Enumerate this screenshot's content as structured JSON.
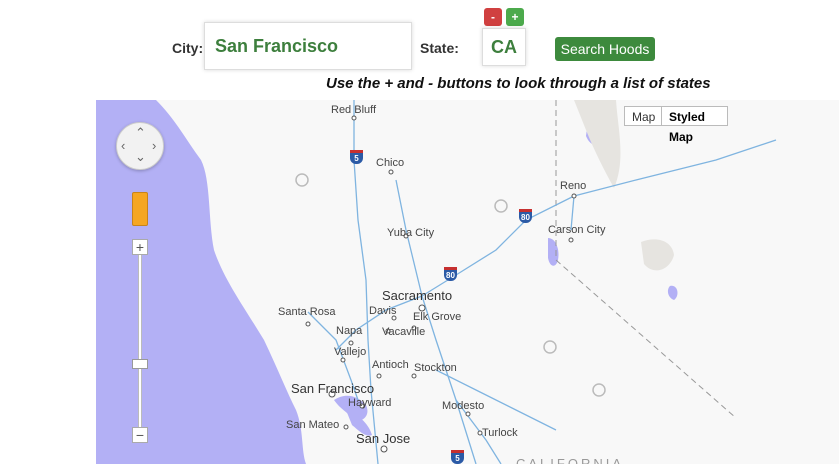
{
  "form": {
    "city_label": "City:",
    "city_value": "San Francisco",
    "state_label": "State:",
    "state_value": "CA",
    "minus_label": "-",
    "plus_label": "+",
    "search_label": "Search Hoods",
    "hint": "Use the + and - buttons to look through a list of states"
  },
  "map": {
    "type_buttons": [
      "Map",
      "Styled Map"
    ],
    "zoom_in": "+",
    "zoom_out": "−",
    "cities": {
      "red_bluff": "Red Bluff",
      "chico": "Chico",
      "reno": "Reno",
      "yuba_city": "Yuba City",
      "carson_city": "Carson City",
      "sacramento": "Sacramento",
      "santa_rosa": "Santa Rosa",
      "davis": "Davis",
      "elk_grove": "Elk Grove",
      "napa": "Napa",
      "vacaville": "Vacaville",
      "vallejo": "Vallejo",
      "antioch": "Antioch",
      "stockton": "Stockton",
      "san_francisco": "San Francisco",
      "hayward": "Hayward",
      "modesto": "Modesto",
      "san_mateo": "San Mateo",
      "san_jose": "San Jose",
      "turlock": "Turlock",
      "california": "CALIFORNIA"
    },
    "shields": [
      "5",
      "80",
      "80",
      "5"
    ],
    "colors": {
      "water": "#b3b0f5",
      "roads": "#7fb4e0",
      "land": "#f8f8f8"
    }
  }
}
